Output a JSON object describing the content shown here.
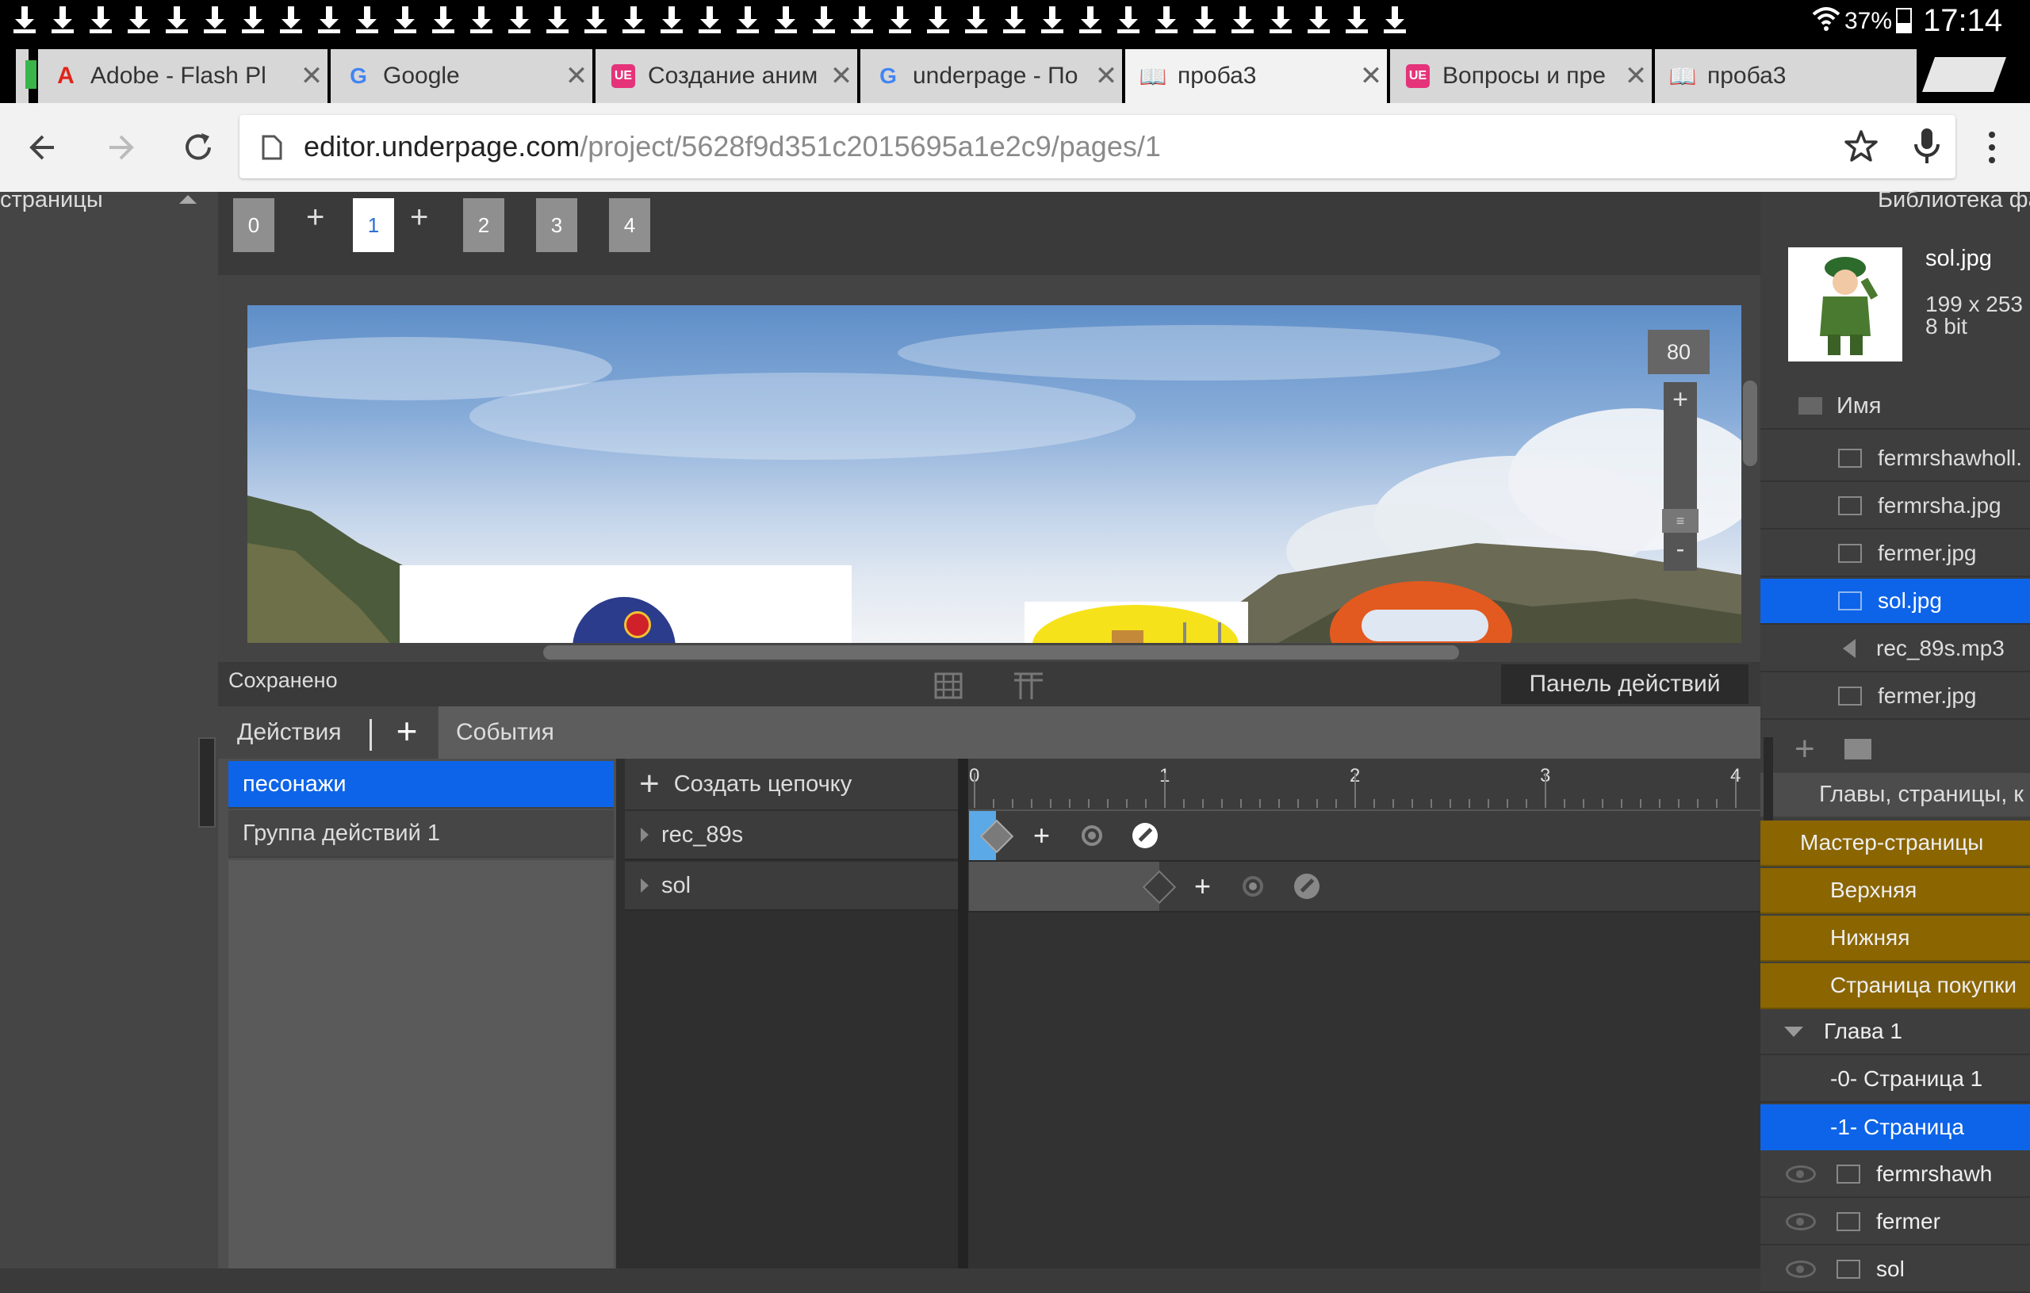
{
  "status_bar": {
    "battery": "37%",
    "time": "17:14",
    "download_count": 37
  },
  "tabs": [
    {
      "title": "Adobe - Flash Pl",
      "favicon": "adobe-icon"
    },
    {
      "title": "Google",
      "favicon": "google-icon"
    },
    {
      "title": "Создание аним",
      "favicon": "ue-icon"
    },
    {
      "title": "underpage - По",
      "favicon": "google-icon"
    },
    {
      "title": "проба3",
      "favicon": "book-icon",
      "active": true
    },
    {
      "title": "Вопросы и пре",
      "favicon": "ue-icon"
    },
    {
      "title": "проба3",
      "favicon": "book-icon"
    }
  ],
  "address": {
    "domain": "editor.underpage.com",
    "path": "/project/5628f9d351c2015695a1e2c9/pages/1"
  },
  "left_panel": {
    "title": "страницы"
  },
  "pages_bar": {
    "pages": [
      "0",
      "1",
      "2",
      "3",
      "4"
    ],
    "active_page": "1",
    "add_symbol": "+"
  },
  "stage": {
    "zoom": "80",
    "zoom_in": "+",
    "zoom_out": "-",
    "zoom_handle": "≡"
  },
  "status_strip": {
    "saved": "Сохранено",
    "actions_panel": "Панель действий"
  },
  "actions": {
    "tab_actions": "Действия",
    "add_symbol": "+",
    "tab_events": "События",
    "groups": [
      "песонажи",
      "Группа действий 1"
    ],
    "selected_group": "песонажи",
    "create_chain": "Создать цепочку",
    "chains": [
      "rec_89s",
      "sol"
    ]
  },
  "timeline": {
    "ruler": [
      "0",
      "1",
      "2",
      "3",
      "4"
    ]
  },
  "library": {
    "title": "Библиотека фа",
    "selected_file": {
      "name": "sol.jpg",
      "dims": "199 x 253",
      "bits": "8 bit"
    },
    "column_name": "Имя",
    "files": [
      {
        "name": "fermrshawholl.",
        "type": "image"
      },
      {
        "name": "fermrsha.jpg",
        "type": "image"
      },
      {
        "name": "fermer.jpg",
        "type": "image"
      },
      {
        "name": "sol.jpg",
        "type": "image",
        "selected": true
      },
      {
        "name": "rec_89s.mp3",
        "type": "sound"
      },
      {
        "name": "fermer.jpg",
        "type": "image"
      }
    ]
  },
  "chapters": {
    "title": "Главы, страницы, к",
    "master_pages": "Мастер-страницы",
    "masters": [
      "Верхняя",
      "Нижняя",
      "Страница покупки"
    ],
    "chapter": "Глава 1",
    "pages": [
      "-0-  Страница 1",
      "-1-  Страница"
    ],
    "selected_page": "-1-  Страница",
    "layers": [
      "fermrshawh",
      "fermer",
      "sol"
    ]
  },
  "colors": {
    "accent": "#0d64e8",
    "master_gold": "#8a6500",
    "panel_dark": "#3a3a3a"
  }
}
